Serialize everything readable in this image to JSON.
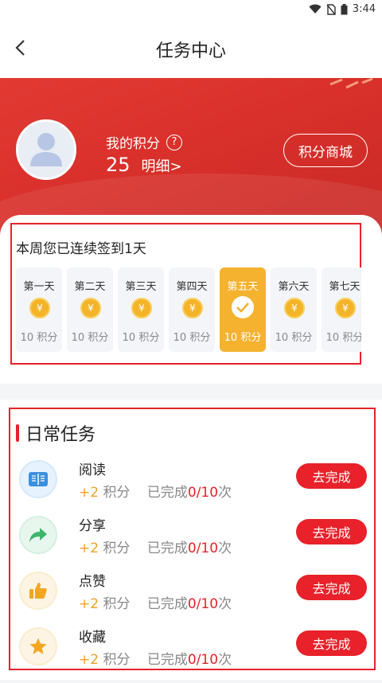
{
  "status_bar": {
    "time": "3:44"
  },
  "nav": {
    "title": "任务中心"
  },
  "profile": {
    "points_label": "我的积分",
    "help_icon": "question-circle-icon",
    "points_value": "25",
    "detail_link": "明细>",
    "mall_button": "积分商城"
  },
  "checkin": {
    "title": "本周您已连续签到1天",
    "days": [
      {
        "label": "第一天",
        "points": "10 积分",
        "status": "unclaimed"
      },
      {
        "label": "第二天",
        "points": "10 积分",
        "status": "unclaimed"
      },
      {
        "label": "第三天",
        "points": "10 积分",
        "status": "unclaimed"
      },
      {
        "label": "第四天",
        "points": "10 积分",
        "status": "unclaimed"
      },
      {
        "label": "第五天",
        "points": "10 积分",
        "status": "checked"
      },
      {
        "label": "第六天",
        "points": "10 积分",
        "status": "unclaimed"
      },
      {
        "label": "第七天",
        "points": "10 积分",
        "status": "unclaimed"
      }
    ],
    "coin_symbol": "¥"
  },
  "daily_tasks": {
    "title": "日常任务",
    "items": [
      {
        "name": "阅读",
        "reward": "+2",
        "unit": "积分",
        "done_label": "已完成",
        "progress": "0/10",
        "suffix": "次",
        "button": "去完成",
        "icon": "book-icon",
        "color": "#3a8fe0"
      },
      {
        "name": "分享",
        "reward": "+2",
        "unit": "积分",
        "done_label": "已完成",
        "progress": "0/10",
        "suffix": "次",
        "button": "去完成",
        "icon": "share-arrow-icon",
        "color": "#3fb66b"
      },
      {
        "name": "点赞",
        "reward": "+2",
        "unit": "积分",
        "done_label": "已完成",
        "progress": "0/10",
        "suffix": "次",
        "button": "去完成",
        "icon": "thumbs-up-icon",
        "color": "#f4a623"
      },
      {
        "name": "收藏",
        "reward": "+2",
        "unit": "积分",
        "done_label": "已完成",
        "progress": "0/10",
        "suffix": "次",
        "button": "去完成",
        "icon": "star-icon",
        "color": "#f4a623"
      }
    ]
  },
  "colors": {
    "accent": "#e8212a",
    "gold": "#f5b22f",
    "hero_red": "#d9302b"
  }
}
